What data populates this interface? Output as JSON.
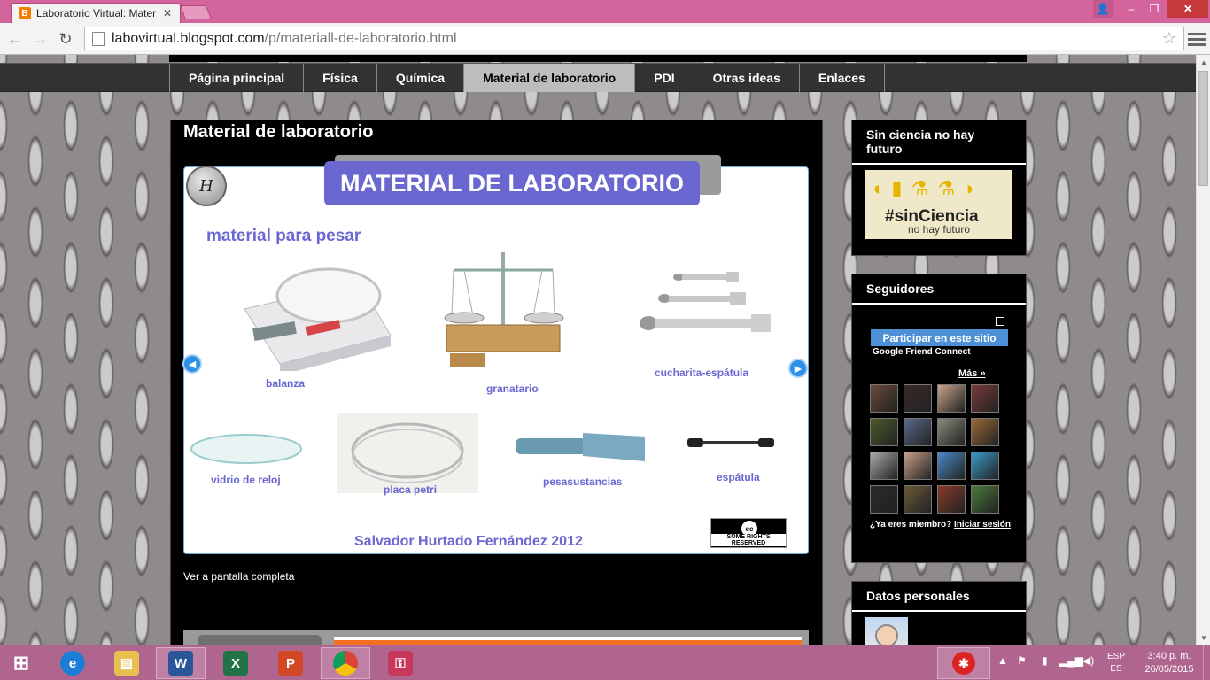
{
  "browser": {
    "tab_title": "Laboratorio Virtual: Mater",
    "tab_favicon": "B",
    "url_host": "labovirtual.blogspot.com",
    "url_path": "/p/materiall-de-laboratorio.html"
  },
  "nav": {
    "items": [
      "Página principal",
      "Física",
      "Química",
      "Material de laboratorio",
      "PDI",
      "Otras ideas",
      "Enlaces"
    ],
    "active": "Material de laboratorio"
  },
  "post": {
    "title": "Material de laboratorio",
    "fullscreen_link": "Ver a pantalla completa"
  },
  "slide": {
    "logo_text": "H",
    "header": "MATERIAL DE LABORATORIO",
    "section_heading": "material para pesar",
    "items": [
      {
        "label": "balanza"
      },
      {
        "label": "granatario"
      },
      {
        "label": "cucharita-espátula"
      },
      {
        "label": "vidrio de reloj"
      },
      {
        "label": "placa petri"
      },
      {
        "label": "pesasustancias"
      },
      {
        "label": "espátula"
      }
    ],
    "credit": "Salvador Hurtado Fernández 2012",
    "cc_badge": "SOME RIGHTS RESERVED",
    "cc_symbol": "cc"
  },
  "sidebar": {
    "widget1": {
      "title": "Sin ciencia no hay futuro",
      "banner_main": "#sinCiencia",
      "banner_sub": "no hay futuro"
    },
    "widget2": {
      "title": "Seguidores",
      "join_button": "Participar en este sitio",
      "gfc": "Google Friend Connect",
      "more": "Más »",
      "member_prompt": "¿Ya eres miembro?",
      "signin": "Iniciar sesión",
      "follower_colors": [
        "#6a4a3a",
        "#3a2a2a",
        "#c7a48a",
        "#7a3a3a",
        "#4a5a2a",
        "#5a6a8a",
        "#8a8a7a",
        "#9a6a3a",
        "#aaaaaa",
        "#c8a088",
        "#4a8ac8",
        "#3a9ac8",
        "#2a2a2a",
        "#6a5a3a",
        "#8a3a2a",
        "#4a7a3a"
      ]
    },
    "widget3": {
      "title": "Datos personales"
    }
  },
  "taskbar": {
    "lang_top": "ESP",
    "lang_bottom": "ES",
    "time": "3:40 p. m.",
    "date": "26/05/2015"
  }
}
